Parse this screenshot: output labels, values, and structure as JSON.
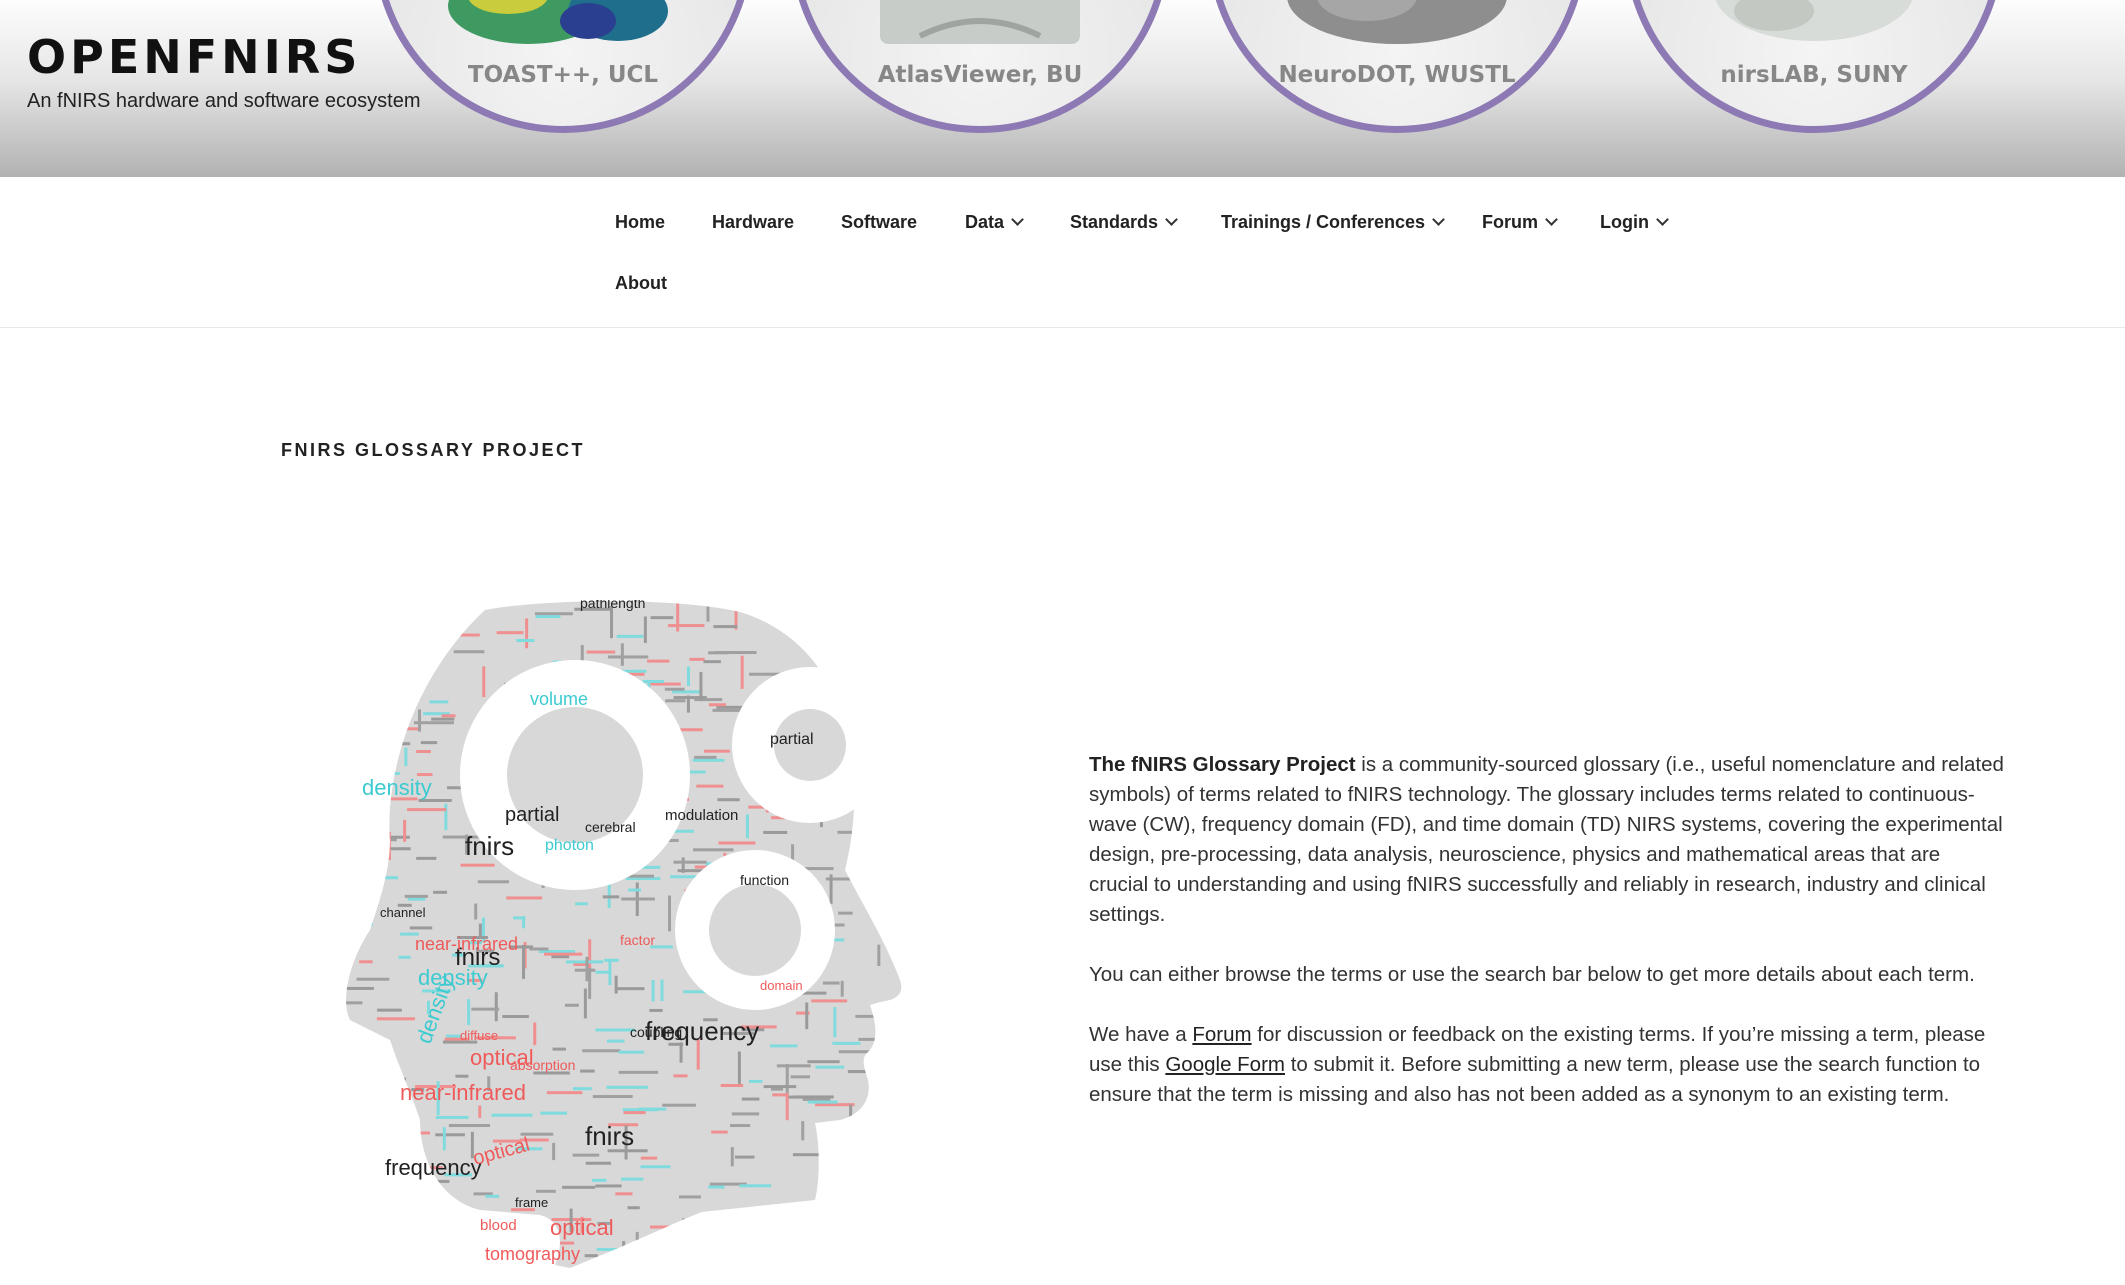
{
  "site": {
    "title": "OPENFNIRS",
    "description": "An fNIRS hardware and software ecosystem"
  },
  "header_tools": [
    {
      "label": "TOAST++, UCL",
      "icon": "brain-mesh-icon"
    },
    {
      "label": "AtlasViewer, BU",
      "icon": "head-model-icon"
    },
    {
      "label": "NeuroDOT, WUSTL",
      "icon": "brain-gray-icon"
    },
    {
      "label": "nirsLAB, SUNY",
      "icon": "head-white-icon"
    }
  ],
  "nav": {
    "items": [
      {
        "label": "Home",
        "dropdown": false
      },
      {
        "label": "Hardware",
        "dropdown": false
      },
      {
        "label": "Software",
        "dropdown": false
      },
      {
        "label": "Data",
        "dropdown": true
      },
      {
        "label": "Standards",
        "dropdown": true
      },
      {
        "label": "Trainings / Conferences",
        "dropdown": true
      },
      {
        "label": "Forum",
        "dropdown": true
      },
      {
        "label": "Login",
        "dropdown": true
      },
      {
        "label": "About",
        "dropdown": false
      }
    ]
  },
  "page": {
    "title": "FNIRS GLOSSARY PROJECT",
    "intro": {
      "strong": "The fNIRS Glossary Project",
      "rest": " is a community-sourced glossary  (i.e., useful nomenclature and related symbols) of terms related to fNIRS technology. The glossary includes terms related to continuous-wave (CW), frequency domain (FD), and time domain (TD) NIRS systems, covering the experimental design, pre-processing, data analysis, neuroscience, physics and mathematical areas that are crucial to understanding and using fNIRS successfully and reliably in research, industry and clinical settings."
    },
    "browse": "You can either browse the terms or use the search bar below to get more details about each term.",
    "feedback": {
      "p1": "We have a ",
      "forum_link": "Forum",
      "p2": " for discussion or feedback on the existing terms. If you’re missing a term, please use this ",
      "form_link": "Google Form",
      "p3": " to submit it. Before submitting a new term, please use the search function to ensure that the term is missing and also has not been added as a synonym to an existing term."
    }
  },
  "wordcloud": {
    "big_words": [
      {
        "text": "fnirs",
        "color": "#222222"
      },
      {
        "text": "fnirs",
        "color": "#222222"
      },
      {
        "text": "fnirs",
        "color": "#222222"
      },
      {
        "text": "frequency",
        "color": "#222222"
      },
      {
        "text": "frequency",
        "color": "#222222"
      },
      {
        "text": "density",
        "color": "#3ccbd0"
      },
      {
        "text": "density",
        "color": "#3ccbd0"
      },
      {
        "text": "density",
        "color": "#3ccbd0"
      },
      {
        "text": "optical",
        "color": "#ef5a5a"
      },
      {
        "text": "optical",
        "color": "#ef5a5a"
      },
      {
        "text": "optical",
        "color": "#ef5a5a"
      },
      {
        "text": "near-infrared",
        "color": "#ef5a5a"
      },
      {
        "text": "near-infrared",
        "color": "#ef5a5a"
      },
      {
        "text": "tomography",
        "color": "#ef5a5a"
      },
      {
        "text": "partial",
        "color": "#222222"
      },
      {
        "text": "partial",
        "color": "#222222"
      },
      {
        "text": "photon",
        "color": "#3ccbd0"
      },
      {
        "text": "volume",
        "color": "#3ccbd0"
      },
      {
        "text": "modulation",
        "color": "#222222"
      },
      {
        "text": "pathlength",
        "color": "#222222"
      },
      {
        "text": "cerebral",
        "color": "#222222"
      },
      {
        "text": "absorption",
        "color": "#ef5a5a"
      },
      {
        "text": "coupling",
        "color": "#222222"
      },
      {
        "text": "channel",
        "color": "#222222"
      },
      {
        "text": "blood",
        "color": "#ef5a5a"
      },
      {
        "text": "domain",
        "color": "#ef5a5a"
      },
      {
        "text": "function",
        "color": "#222222"
      },
      {
        "text": "frame",
        "color": "#222222"
      },
      {
        "text": "diffuse",
        "color": "#ef5a5a"
      },
      {
        "text": "factor",
        "color": "#ef5a5a"
      }
    ]
  }
}
